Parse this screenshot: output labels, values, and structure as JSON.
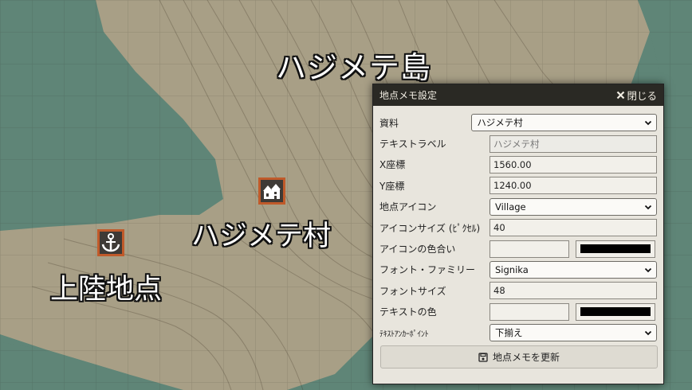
{
  "map": {
    "island_label": "ハジメテ島",
    "village_label": "ハジメテ村",
    "landing_label": "上陸地点",
    "village_icon": "village-icon",
    "landing_icon": "anchor-icon",
    "colors": {
      "sea": "#5f8577",
      "land": "#a89f86",
      "marker_border": "#c05a2a"
    }
  },
  "dialog": {
    "title": "地点メモ設定",
    "close_label": "閉じる",
    "fields": {
      "resource": {
        "label": "資料",
        "value": "ハジメテ村"
      },
      "text_label": {
        "label": "テキストラベル",
        "value": "ハジメテ村"
      },
      "x": {
        "label": "X座標",
        "value": "1560.00"
      },
      "y": {
        "label": "Y座標",
        "value": "1240.00"
      },
      "icon": {
        "label": "地点アイコン",
        "value": "Village"
      },
      "icon_size": {
        "label": "アイコンサイズ (ﾋﾟｸｾﾙ)",
        "value": "40"
      },
      "icon_tint": {
        "label": "アイコンの色合い",
        "color": "#000000"
      },
      "font_family": {
        "label": "フォント・ファミリー",
        "value": "Signika"
      },
      "font_size": {
        "label": "フォントサイズ",
        "value": "48"
      },
      "text_color": {
        "label": "テキストの色",
        "color": "#000000"
      },
      "anchor": {
        "label": "ﾃｷｽﾄｱﾝｶｰﾎﾟｲﾝﾄ",
        "value": "下揃え"
      }
    },
    "update_label": "地点メモを更新"
  }
}
